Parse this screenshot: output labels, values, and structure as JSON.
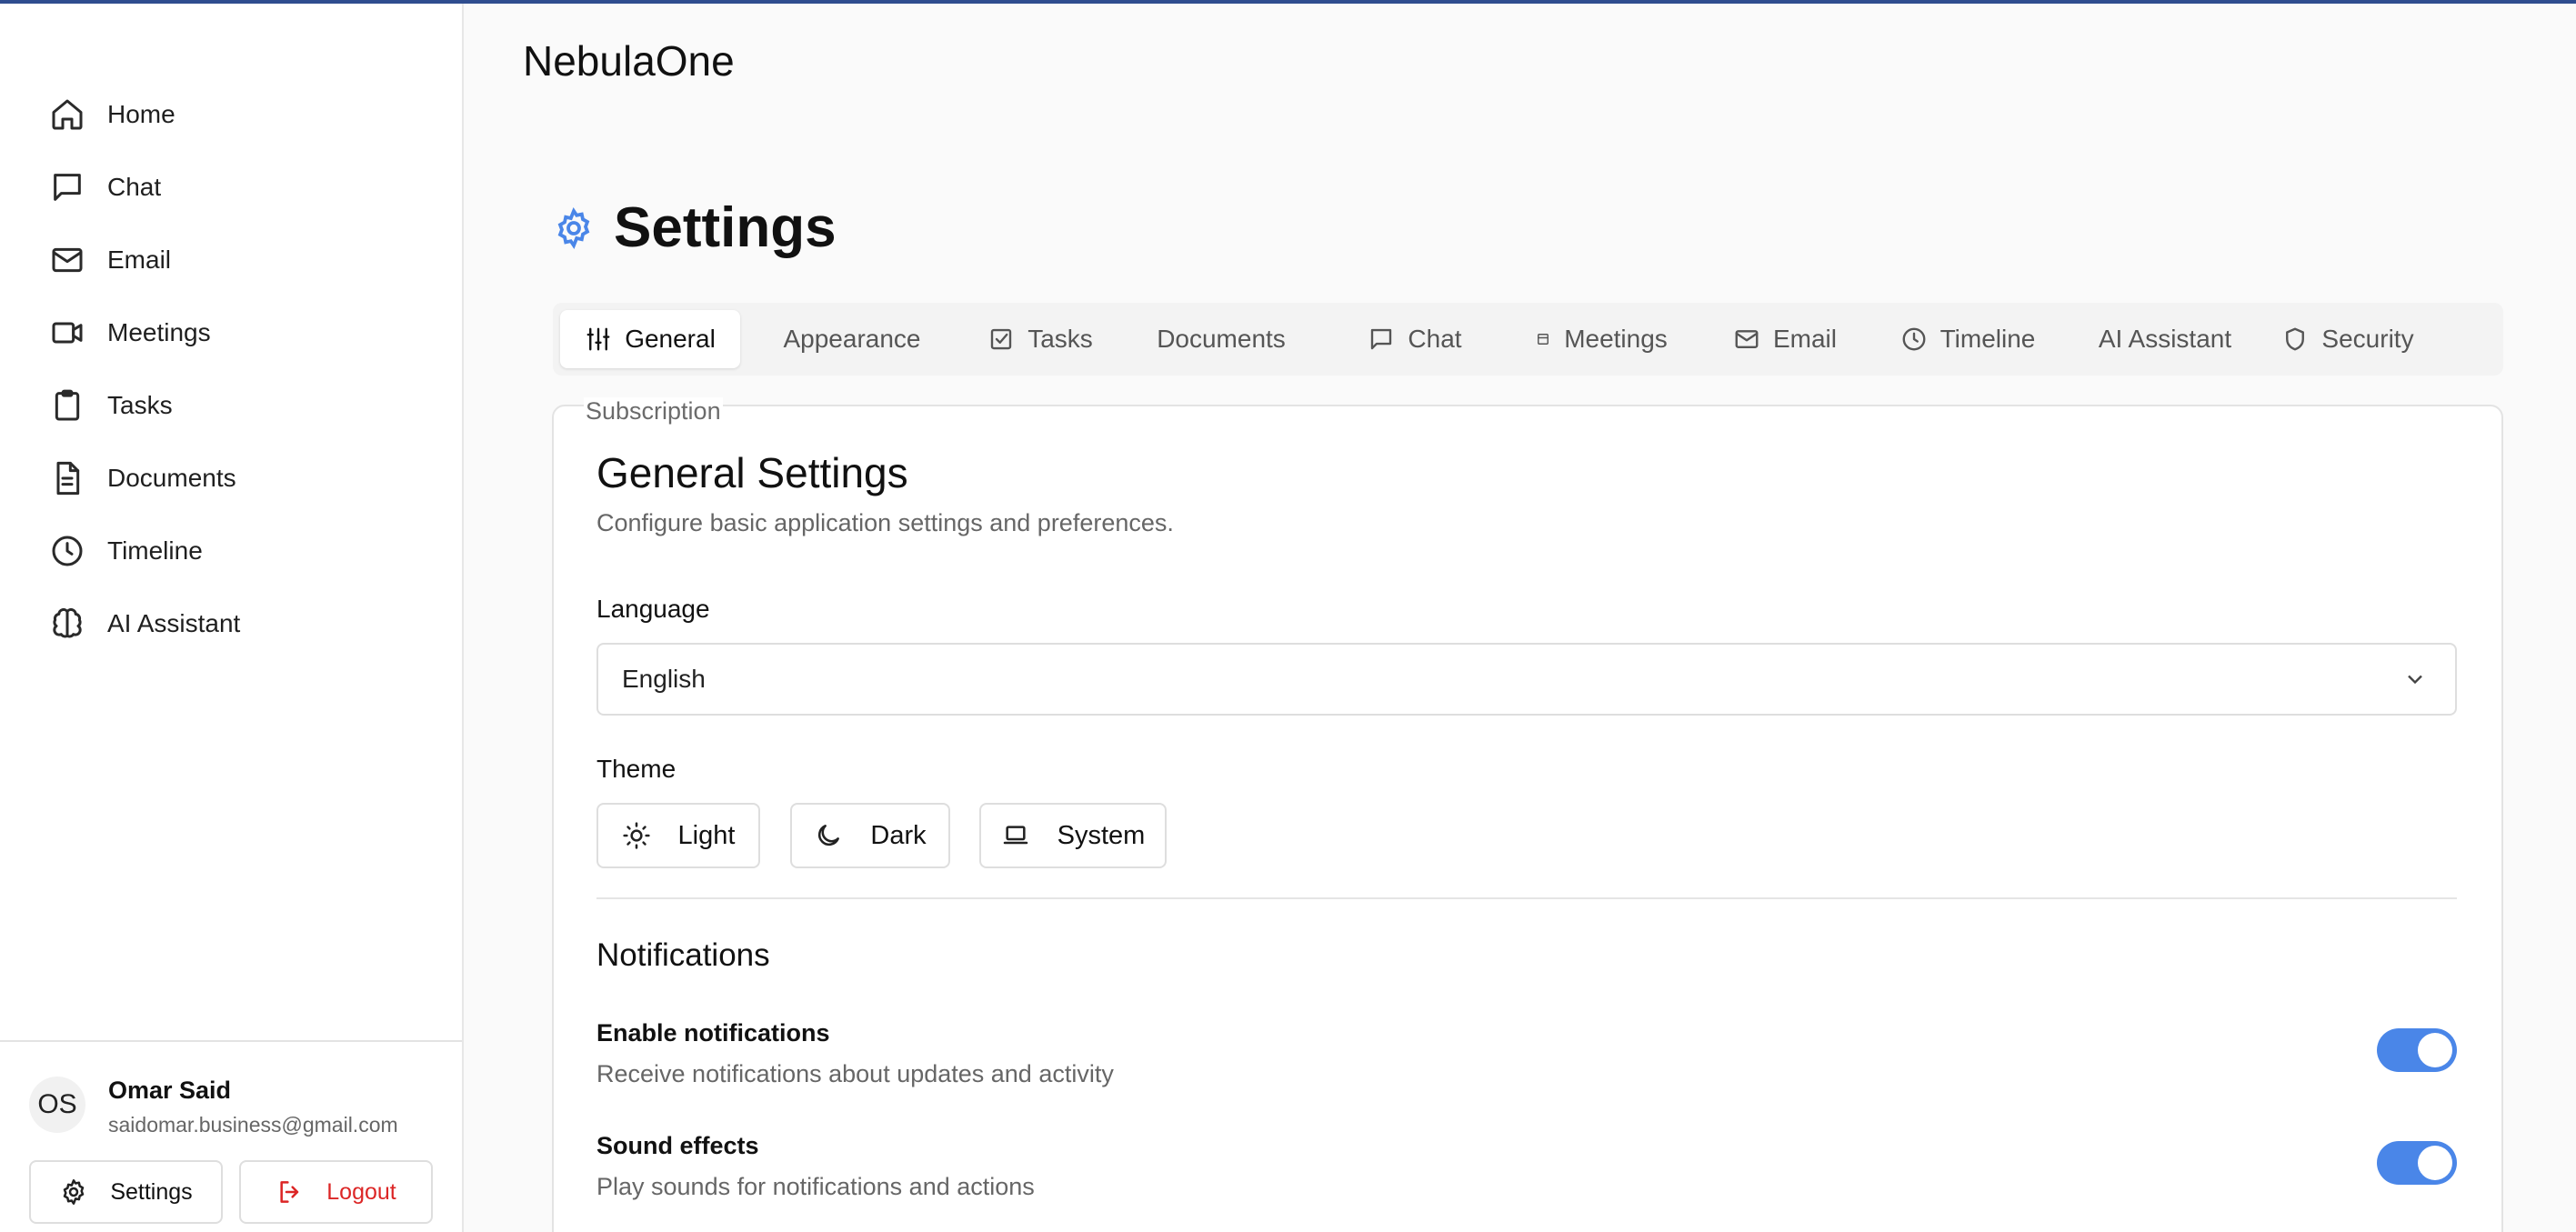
{
  "app": {
    "title": "NebulaOne"
  },
  "sidebar": {
    "items": [
      {
        "label": "Home",
        "icon": "home-icon"
      },
      {
        "label": "Chat",
        "icon": "chat-icon"
      },
      {
        "label": "Email",
        "icon": "mail-icon"
      },
      {
        "label": "Meetings",
        "icon": "video-icon"
      },
      {
        "label": "Tasks",
        "icon": "clipboard-icon"
      },
      {
        "label": "Documents",
        "icon": "document-icon"
      },
      {
        "label": "Timeline",
        "icon": "clock-icon"
      },
      {
        "label": "AI Assistant",
        "icon": "brain-icon"
      }
    ],
    "user": {
      "initials": "OS",
      "name": "Omar Said",
      "email": "saidomar.business@gmail.com"
    },
    "settings_label": "Settings",
    "logout_label": "Logout"
  },
  "page": {
    "title": "Settings"
  },
  "tabs": [
    {
      "label": "General",
      "icon": "sliders-icon",
      "active": true
    },
    {
      "label": "Appearance",
      "icon": "",
      "active": false
    },
    {
      "label": "Tasks",
      "icon": "check-square-icon",
      "active": false
    },
    {
      "label": "Documents",
      "icon": "",
      "active": false
    },
    {
      "label": "Chat",
      "icon": "chat-icon",
      "active": false
    },
    {
      "label": "Meetings",
      "icon": "calendar-icon",
      "active": false
    },
    {
      "label": "Email",
      "icon": "mail-icon",
      "active": false
    },
    {
      "label": "Timeline",
      "icon": "clock-icon",
      "active": false
    },
    {
      "label": "AI Assistant",
      "icon": "",
      "active": false
    },
    {
      "label": "Security",
      "icon": "shield-icon",
      "active": false
    }
  ],
  "general": {
    "subscription_label": "Subscription",
    "title": "General Settings",
    "description": "Configure basic application settings and preferences.",
    "language": {
      "label": "Language",
      "value": "English"
    },
    "theme": {
      "label": "Theme",
      "options": [
        {
          "label": "Light",
          "icon": "sun-icon"
        },
        {
          "label": "Dark",
          "icon": "moon-icon"
        },
        {
          "label": "System",
          "icon": "laptop-icon"
        }
      ]
    },
    "notifications": {
      "title": "Notifications",
      "items": [
        {
          "title": "Enable notifications",
          "description": "Receive notifications about updates and activity",
          "enabled": true
        },
        {
          "title": "Sound effects",
          "description": "Play sounds for notifications and actions",
          "enabled": true
        }
      ]
    }
  },
  "colors": {
    "accent": "#4a86e8",
    "danger": "#dc2626",
    "topbar": "#2f4d8f"
  }
}
